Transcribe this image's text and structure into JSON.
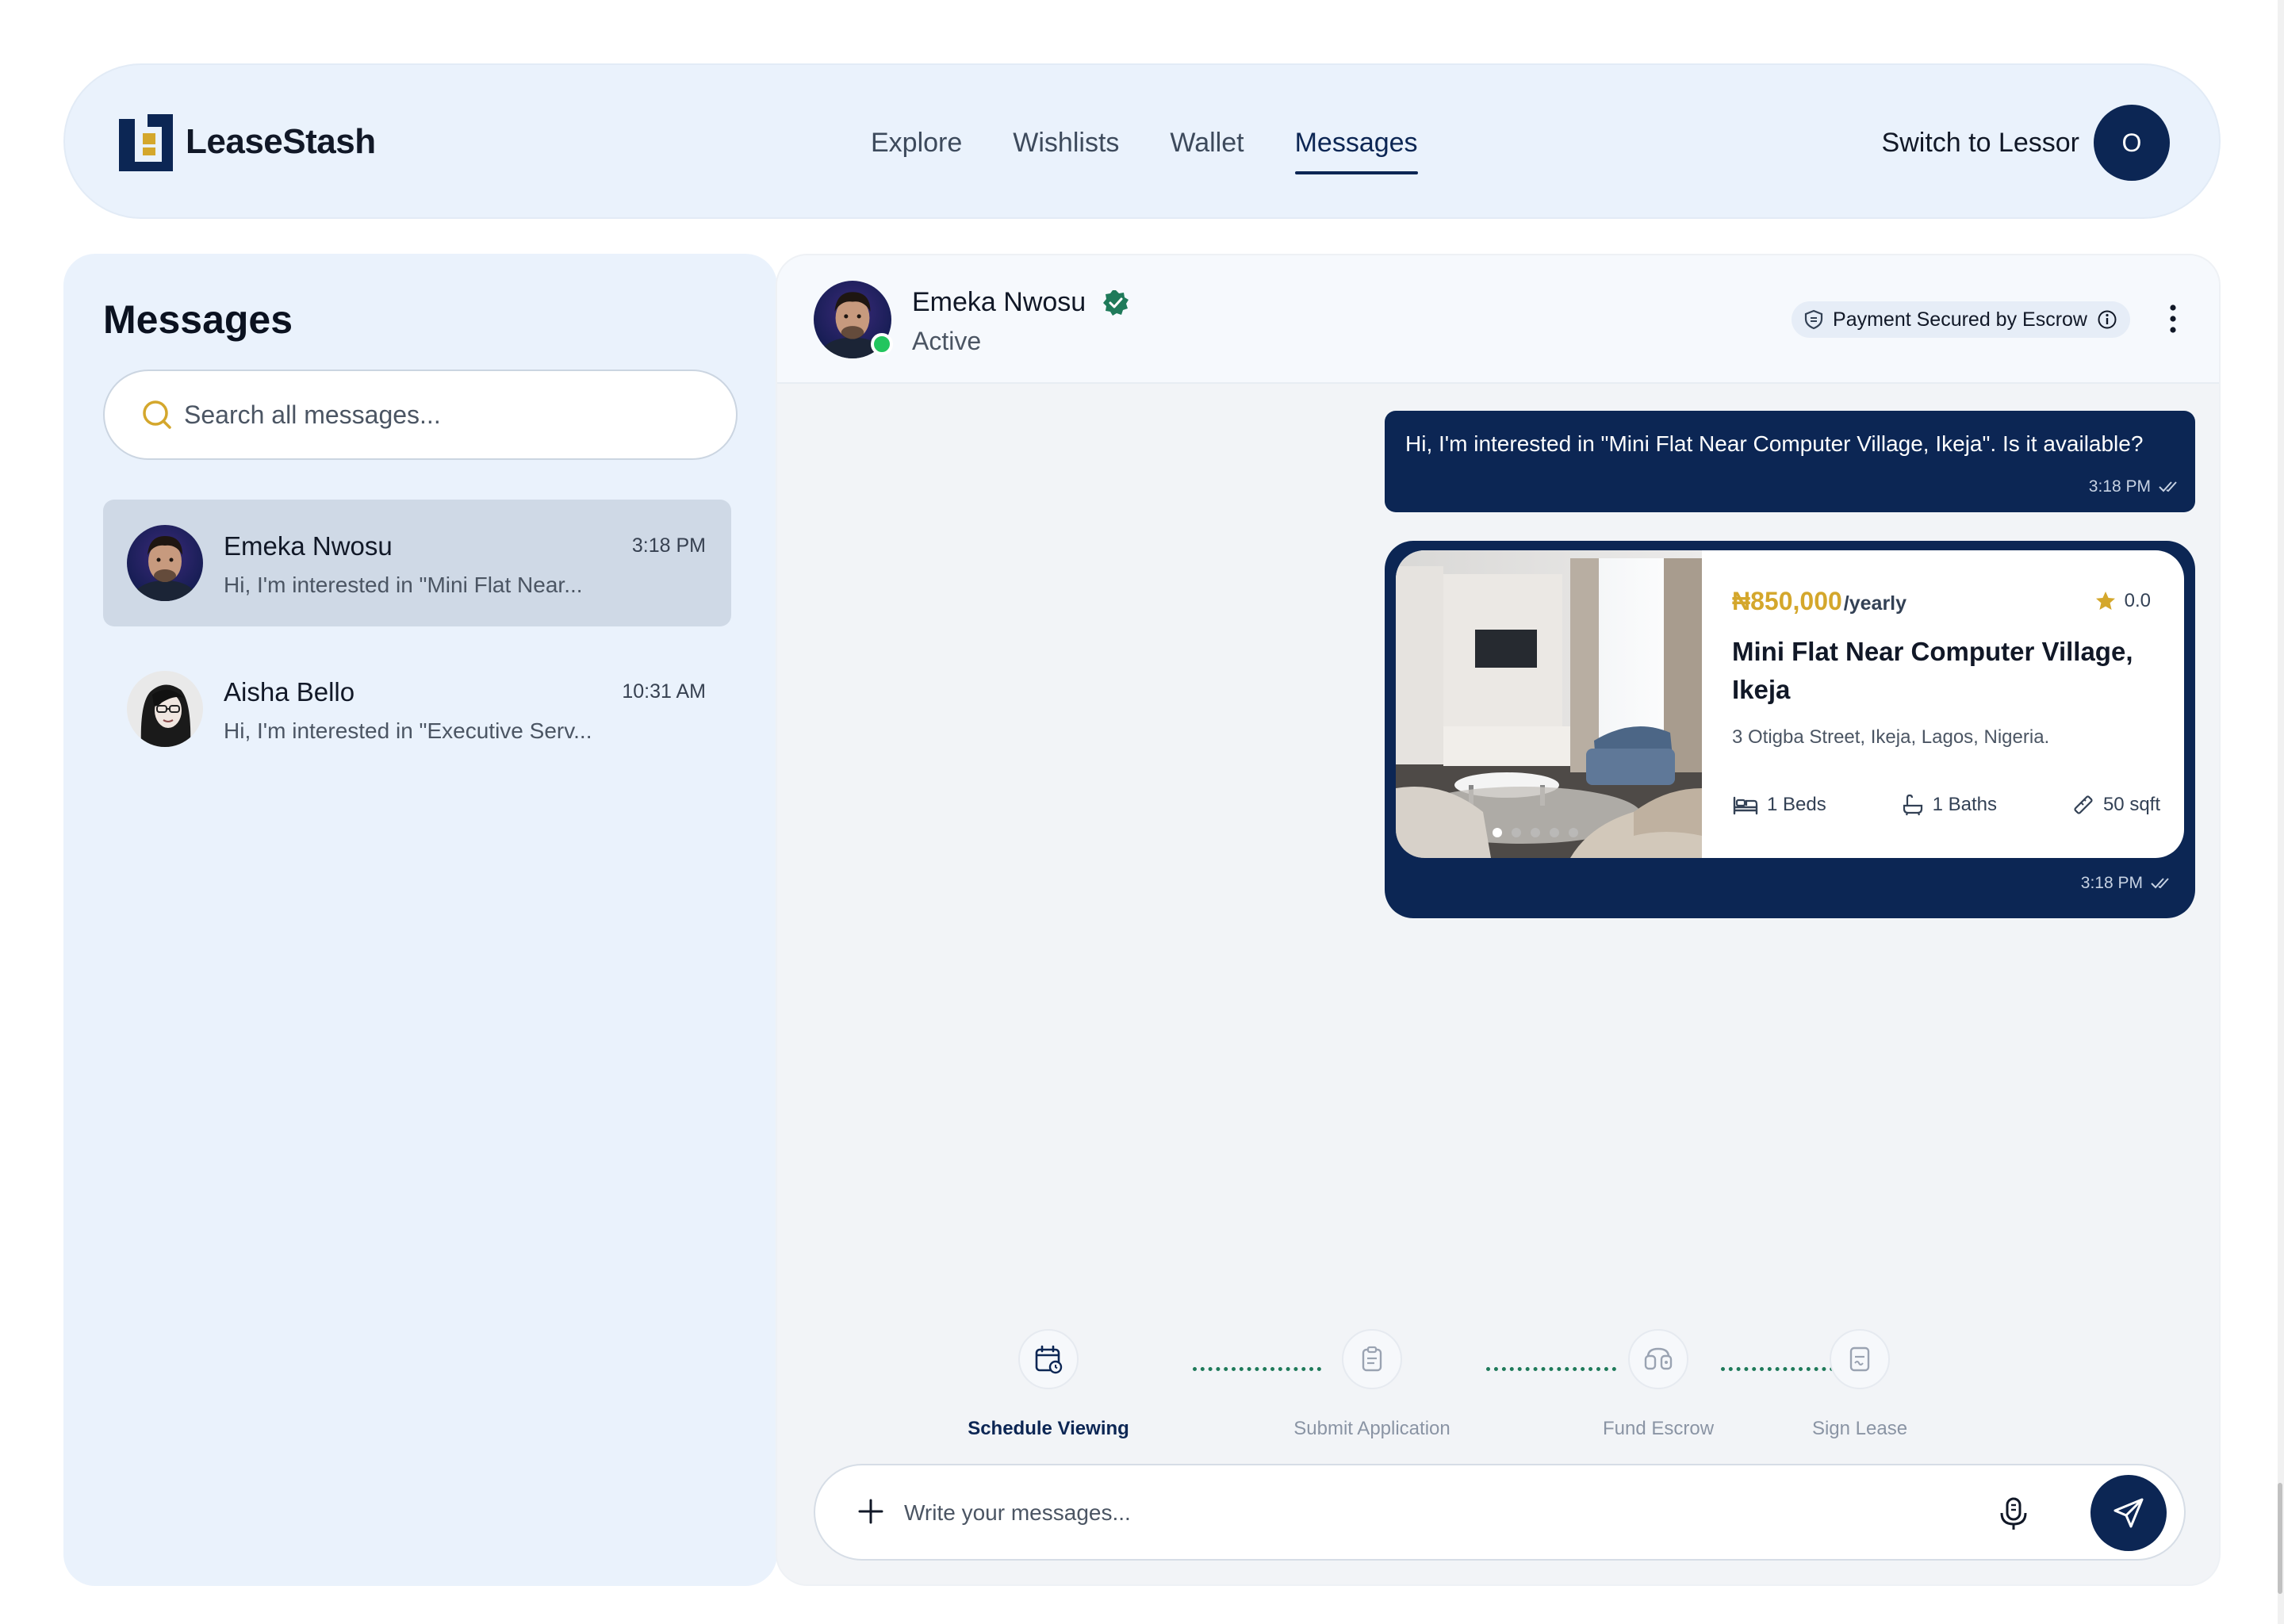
{
  "brand": {
    "name": "LeaseStash"
  },
  "nav": {
    "items": [
      {
        "label": "Explore"
      },
      {
        "label": "Wishlists"
      },
      {
        "label": "Wallet"
      },
      {
        "label": "Messages"
      }
    ],
    "active": "Messages",
    "switch_label": "Switch to Lessor",
    "user_initial": "O"
  },
  "sidebar": {
    "title": "Messages",
    "search_placeholder": "Search all messages...",
    "conversations": [
      {
        "name": "Emeka Nwosu",
        "time": "3:18 PM",
        "preview": "Hi, I'm interested in \"Mini Flat Near...",
        "active": true
      },
      {
        "name": "Aisha Bello",
        "time": "10:31 AM",
        "preview": "Hi, I'm interested in \"Executive Serv...",
        "active": false
      }
    ]
  },
  "chat": {
    "contact_name": "Emeka Nwosu",
    "status": "Active",
    "escrow_label": "Payment Secured by Escrow",
    "messages": [
      {
        "text": "Hi, I'm interested in \"Mini Flat Near Computer Village, Ikeja\". Is it available?",
        "time": "3:18 PM"
      },
      {
        "type": "property_card",
        "time": "3:18 PM",
        "property": {
          "price": "₦850,000",
          "period": "/yearly",
          "rating": "0.0",
          "title": "Mini Flat Near Computer Village, Ikeja",
          "address": "3 Otigba Street, Ikeja, Lagos, Nigeria.",
          "beds": "1 Beds",
          "baths": "1 Baths",
          "area": "50 sqft"
        }
      }
    ],
    "steps": [
      {
        "label": "Schedule Viewing",
        "active": true
      },
      {
        "label": "Submit Application",
        "active": false
      },
      {
        "label": "Fund Escrow",
        "active": false
      },
      {
        "label": "Sign Lease",
        "active": false
      }
    ],
    "composer_placeholder": "Write your messages..."
  },
  "colors": {
    "navy": "#0c2654",
    "gold": "#d4a72c",
    "panel": "#eaf2fc",
    "online": "#22c55e",
    "verified": "#1f7a5a"
  }
}
